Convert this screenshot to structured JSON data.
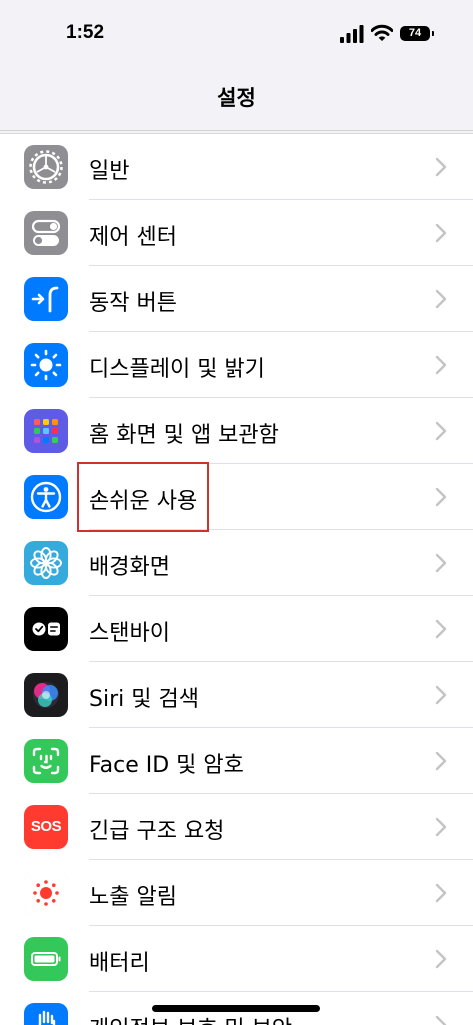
{
  "status_bar": {
    "time": "1:52",
    "battery": "74"
  },
  "nav": {
    "title": "설정"
  },
  "settings": [
    {
      "label": "일반",
      "icon": "gear-icon",
      "color": "#8e8e93"
    },
    {
      "label": "제어 센터",
      "icon": "toggles-icon",
      "color": "#8e8e93"
    },
    {
      "label": "동작 버튼",
      "icon": "action-button-icon",
      "color": "#007aff"
    },
    {
      "label": "디스플레이 및 밝기",
      "icon": "sun-icon",
      "color": "#007aff"
    },
    {
      "label": "홈 화면 및 앱 보관함",
      "icon": "app-grid-icon",
      "color": "#5e5ce6"
    },
    {
      "label": "손쉬운 사용",
      "icon": "accessibility-icon",
      "color": "#007aff"
    },
    {
      "label": "배경화면",
      "icon": "flower-icon",
      "color": "#35aadc"
    },
    {
      "label": "스탠바이",
      "icon": "standby-icon",
      "color": "#000000"
    },
    {
      "label": "Siri 및 검색",
      "icon": "siri-icon",
      "color": "#1c1c1e"
    },
    {
      "label": "Face ID 및 암호",
      "icon": "face-id-icon",
      "color": "#34c759"
    },
    {
      "label": "긴급 구조 요청",
      "icon": "sos-icon",
      "color": "#ff3b30"
    },
    {
      "label": "노출 알림",
      "icon": "exposure-icon",
      "color": "#ffffff"
    },
    {
      "label": "배터리",
      "icon": "battery-icon",
      "color": "#34c759"
    },
    {
      "label": "개인정보 보호 및 보안",
      "icon": "hand-icon",
      "color": "#007aff"
    }
  ],
  "sos_text": "SOS"
}
